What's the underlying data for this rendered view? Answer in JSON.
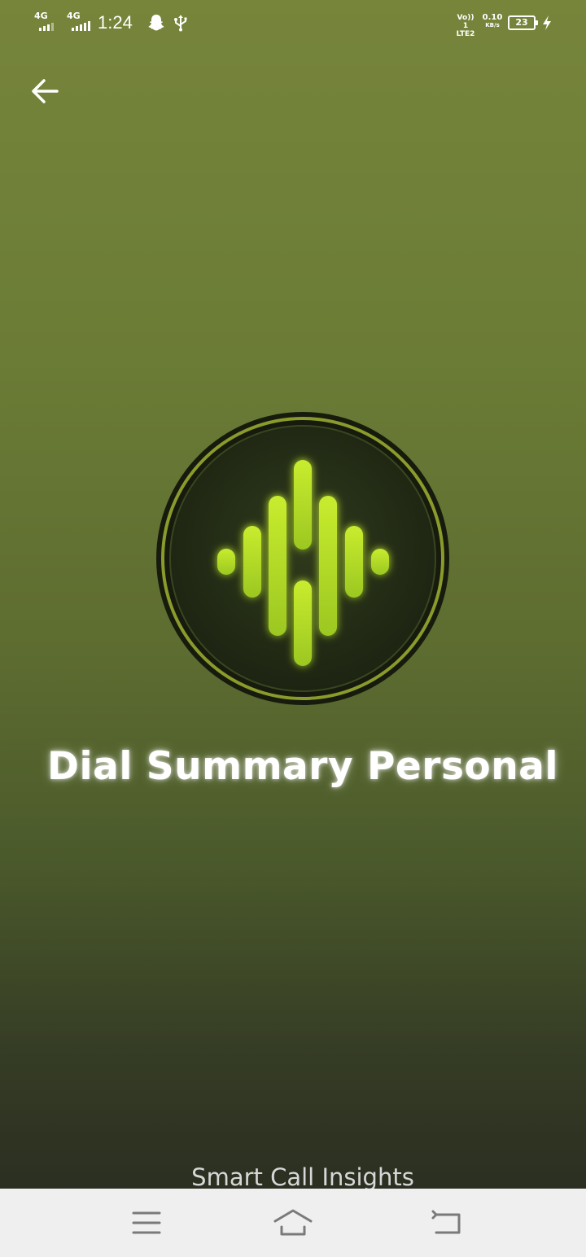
{
  "status_bar": {
    "sim1_network": "4G",
    "sim2_network": "4G",
    "time": "1:24",
    "volte_label": "Vo)) 1",
    "lte_label": "LTE2",
    "net_speed_value": "0.10",
    "net_speed_unit": "KB/s",
    "battery_level": "23",
    "icons": [
      "snapchat-icon",
      "usb-icon",
      "charging-bolt-icon"
    ]
  },
  "header": {
    "back_icon": "arrow-left-icon"
  },
  "splash": {
    "logo_icon": "sound-wave-logo",
    "app_title": "Dial Summary Personal",
    "tagline": "Smart Call Insights"
  },
  "nav_bar": {
    "buttons": [
      "menu-icon",
      "home-icon",
      "back-icon"
    ]
  },
  "colors": {
    "background_top": "#76853a",
    "background_bottom": "#2b2f21",
    "accent_lime": "#b5dc2b",
    "logo_ring": "#8a9b2c",
    "nav_bar_bg": "#efefef"
  }
}
